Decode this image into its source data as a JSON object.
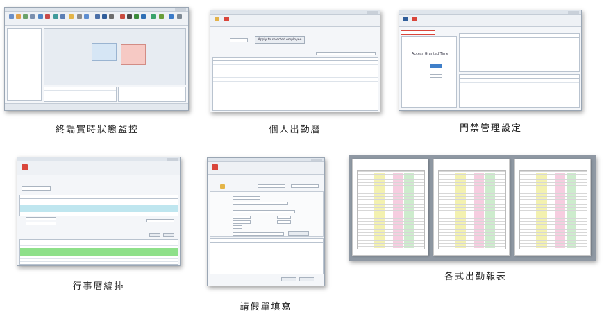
{
  "panels": {
    "monitor": {
      "caption": "終端實時狀態監控"
    },
    "attendance": {
      "caption": "個人出勤曆",
      "apply_button": "Apply to selected employee"
    },
    "access": {
      "caption": "門禁管理設定",
      "panel_title": "Access Granted Time"
    },
    "schedule": {
      "caption": "行事曆編排"
    },
    "leave": {
      "caption": "請假單填寫"
    },
    "reports": {
      "caption": "各式出勤報表"
    }
  },
  "colors": {
    "window_bg": "#f4f6f9",
    "terminal_online": "#d6e6f5",
    "terminal_alarm": "#f6c9c4",
    "schedule_highlight": "#bfe6ef",
    "schedule_green": "#8ee08a",
    "save_red": "#d9463b",
    "report_yellow": "#f3f1b0",
    "report_pink": "#f6cde0",
    "report_green": "#cdeccd"
  }
}
